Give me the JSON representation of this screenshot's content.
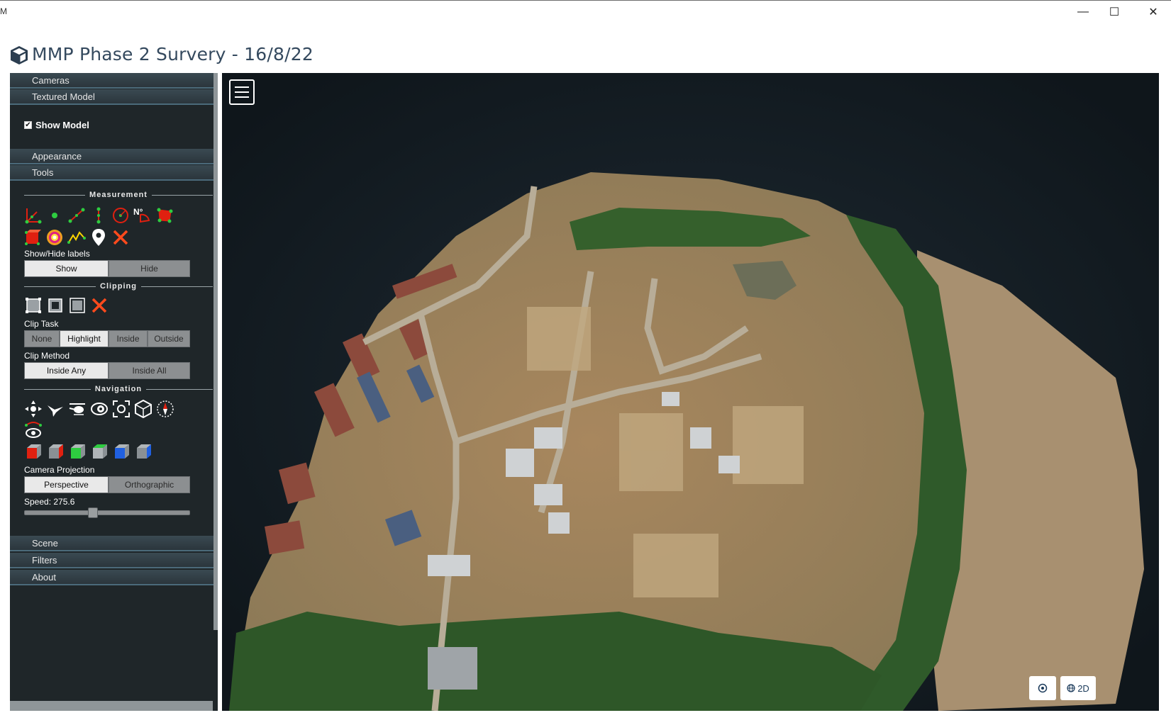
{
  "window": {
    "corner_text": "M",
    "minimize": "—",
    "maximize": "☐",
    "close": "✕"
  },
  "header": {
    "title": "MMP Phase 2 Survery - 16/8/22",
    "logo_icon": "cube-icon"
  },
  "sidebar": {
    "sections": {
      "cameras": "Cameras",
      "textured_model": "Textured Model",
      "appearance": "Appearance",
      "tools": "Tools",
      "scene": "Scene",
      "filters": "Filters",
      "about": "About"
    },
    "show_model": {
      "label": "Show Model",
      "checked": true
    },
    "measurement": {
      "header": "Measurement",
      "tools": [
        "angle-measure-icon",
        "point-measure-icon",
        "distance-measure-icon",
        "height-measure-icon",
        "circle-measure-icon",
        "azimuth-measure-icon",
        "area-measure-icon",
        "volume-measure-icon",
        "sphere-volume-icon",
        "profile-measure-icon",
        "annotation-icon",
        "remove-measurements-icon"
      ],
      "azimuth_label": "N°",
      "labels_title": "Show/Hide labels",
      "show_label": "Show",
      "hide_label": "Hide"
    },
    "clipping": {
      "header": "Clipping",
      "tools": [
        "clip-volume-icon",
        "clip-polygon-icon",
        "screen-clip-box-icon",
        "remove-clipping-icon"
      ],
      "clip_task_title": "Clip Task",
      "clip_task_options": [
        "None",
        "Highlight",
        "Inside",
        "Outside"
      ],
      "clip_task_selected": "Highlight",
      "clip_method_title": "Clip Method",
      "clip_method_options": [
        "Inside Any",
        "Inside All"
      ],
      "clip_method_selected": "Inside Any"
    },
    "navigation": {
      "header": "Navigation",
      "tools": [
        "earth-controls-icon",
        "fly-controls-icon",
        "helicopter-controls-icon",
        "orbit-controls-icon",
        "focus-icon",
        "navigation-cube-icon",
        "compass-icon",
        "camera-animation-icon"
      ],
      "views": [
        "left-view-icon",
        "front-view-icon",
        "top-view-icon",
        "bottom-view-icon",
        "right-view-icon",
        "back-view-icon"
      ],
      "projection_title": "Camera Projection",
      "projection_options": [
        "Perspective",
        "Orthographic"
      ],
      "projection_selected": "Perspective",
      "speed_label": "Speed: 275.6",
      "speed_fraction": 0.41
    }
  },
  "viewport": {
    "menu_icon": "hamburger-menu-icon",
    "locate_icon": "target-icon",
    "mode_label": "2D",
    "mode_icon": "globe-icon"
  },
  "colors": {
    "sidebar_bg": "#1f2629",
    "accordion": "#34434a",
    "accent_red": "#e02010",
    "accent_green": "#2ecc40",
    "title_text": "#34495e"
  }
}
